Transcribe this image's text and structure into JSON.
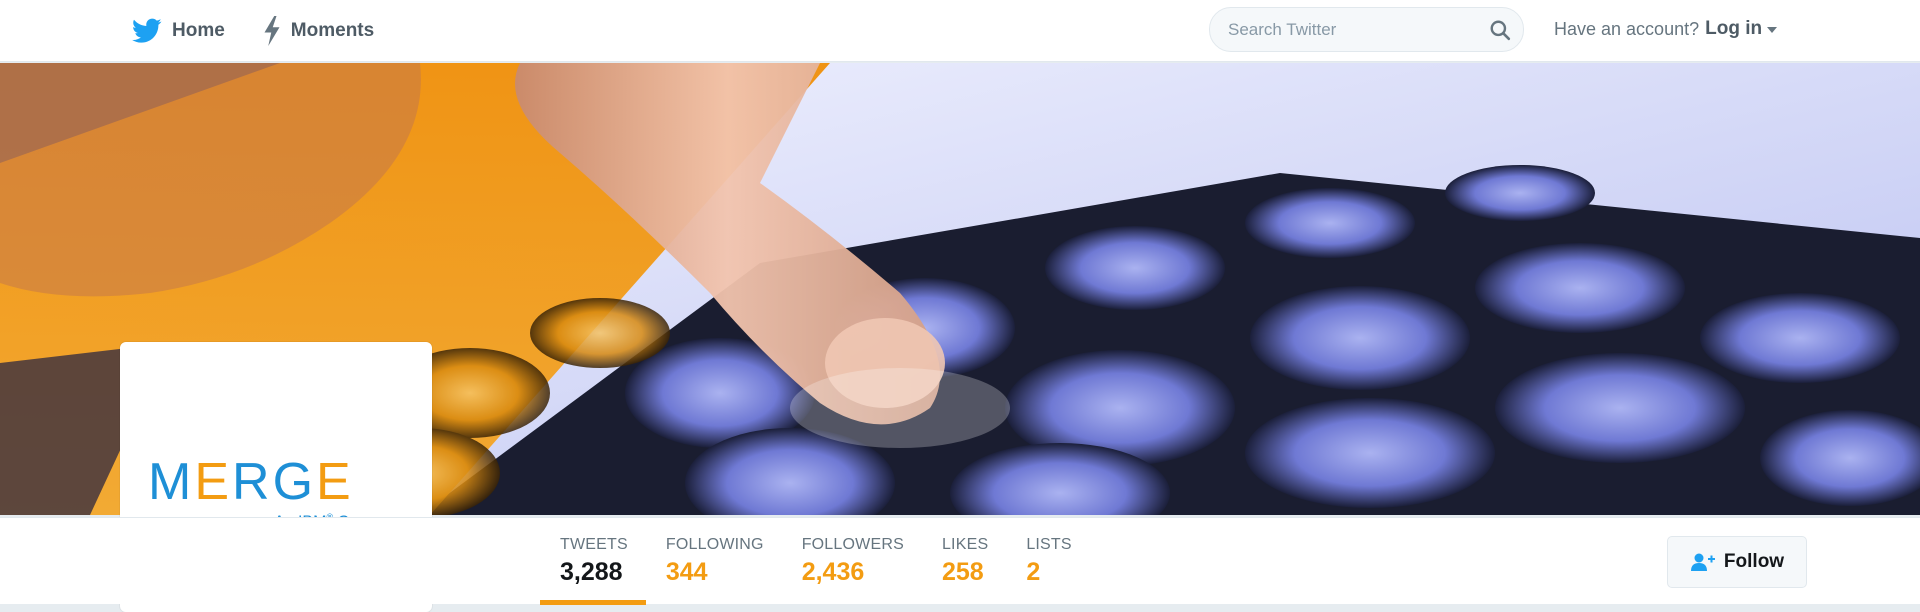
{
  "nav": {
    "home_label": "Home",
    "moments_label": "Moments",
    "icons": {
      "home": "twitter-bird-icon",
      "moments": "lightning-icon"
    }
  },
  "search": {
    "placeholder": "Search Twitter",
    "value": "",
    "icon": "search-icon"
  },
  "account": {
    "prompt": "Have an account?",
    "login_label": "Log in"
  },
  "profile": {
    "logo_text": "MERGE",
    "logo_subtext": "An IBM® Company"
  },
  "stats": [
    {
      "label": "TWEETS",
      "value": "3,288",
      "active": true
    },
    {
      "label": "FOLLOWING",
      "value": "344",
      "active": false
    },
    {
      "label": "FOLLOWERS",
      "value": "2,436",
      "active": false
    },
    {
      "label": "LIKES",
      "value": "258",
      "active": false
    },
    {
      "label": "LISTS",
      "value": "2",
      "active": false
    }
  ],
  "follow_button": {
    "label": "Follow",
    "icon": "add-user-icon"
  },
  "colors": {
    "accent": "#f39c12",
    "twitter_blue": "#1da1f2",
    "logo_blue": "#1e8fd6",
    "text_dark": "#14171a",
    "text_muted": "#66757f"
  }
}
